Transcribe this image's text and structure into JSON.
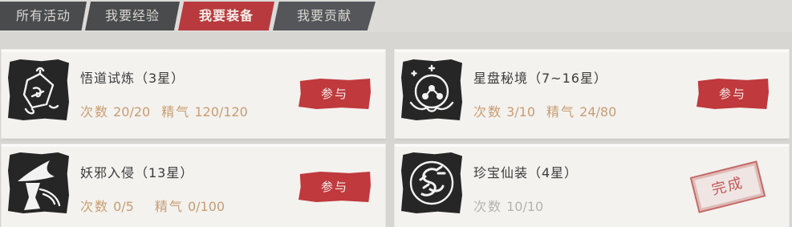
{
  "tabs": [
    {
      "label": "所有活动",
      "active": false
    },
    {
      "label": "我要经验",
      "active": false
    },
    {
      "label": "我要装备",
      "active": true
    },
    {
      "label": "我要贡献",
      "active": false
    }
  ],
  "activities": [
    {
      "title": "悟道试炼（3星）",
      "count_label": "次数",
      "count_value": "20/20",
      "energy_label": "精气",
      "energy_value": "120/120",
      "action": "参与",
      "icon": "dao-lantern-icon"
    },
    {
      "title": "星盘秘境（7~16星）",
      "count_label": "次数",
      "count_value": "3/10",
      "energy_label": "精气",
      "energy_value": "24/80",
      "action": "参与",
      "icon": "star-disc-icon"
    },
    {
      "title": "妖邪入侵（13星）",
      "count_label": "次数",
      "count_value": "0/5",
      "energy_label": "精气",
      "energy_value": "0/100",
      "action": "参与",
      "icon": "swordsman-hat-icon"
    },
    {
      "title": "珍宝仙装（4星）",
      "count_label": "次数",
      "count_value": "10/10",
      "status": "完成",
      "icon": "dragon-emblem-icon"
    }
  ],
  "colors": {
    "accent_red": "#c0393d",
    "tab_dark": "#4a4b4d",
    "stat_gold": "#c89d71",
    "stat_done_gray": "#b5b3ae",
    "card_bg": "#f3f2ef",
    "page_bg": "#d7d6d3"
  }
}
